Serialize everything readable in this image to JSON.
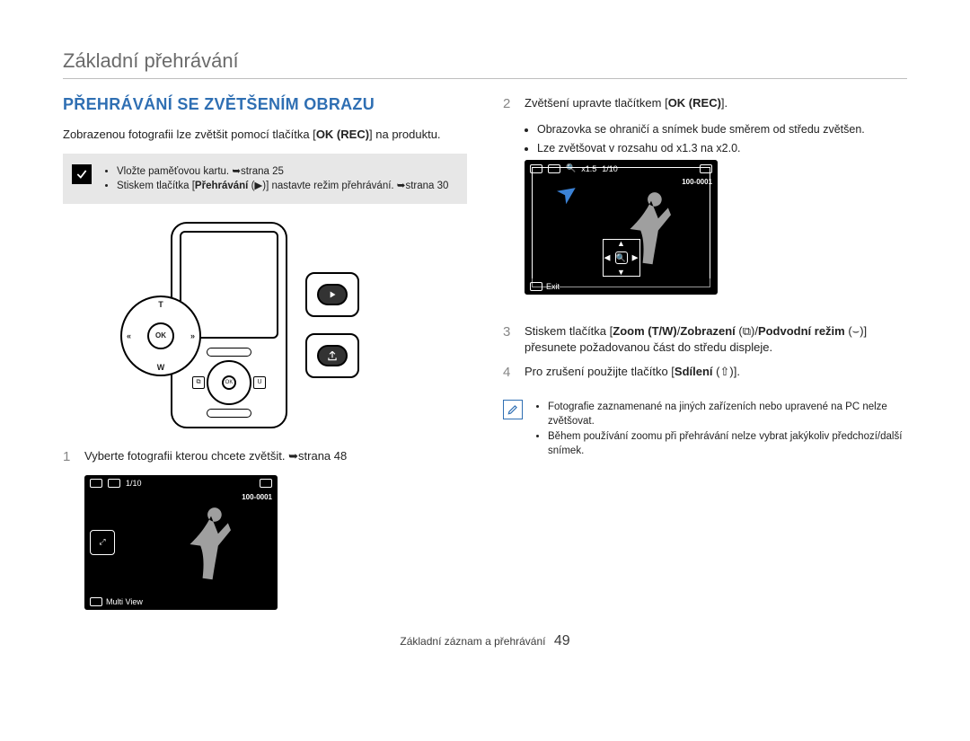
{
  "header": {
    "section_title": "Základní přehrávání"
  },
  "left": {
    "h2": "PŘEHRÁVÁNÍ SE ZVĚTŠENÍM OBRAZU",
    "intro_a": "Zobrazenou fotografii lze zvětšit pomocí tlačítka [",
    "intro_b": "OK (REC)",
    "intro_c": "] na produktu.",
    "prereq": {
      "item1": "Vložte paměťovou kartu. ➥strana 25",
      "item2a": "Stiskem tlačítka [",
      "item2b": "Přehrávání",
      "item2c": " (▶)] nastavte režim přehrávání. ➥strana 30"
    },
    "device": {
      "T": "T",
      "W": "W",
      "L": "«",
      "R": "»",
      "OK": "OK",
      "side_left": "⧉",
      "side_right": "U"
    },
    "step1": {
      "num": "1",
      "text": "Vyberte fotografii kterou chcete zvětšit. ➥strana 48"
    },
    "shot1": {
      "counter": "1/10",
      "file": "100-0001",
      "bottom_label": "Multi View",
      "zoom_icon_label": "⤢"
    }
  },
  "right": {
    "step2": {
      "num": "2",
      "text_a": "Zvětšení upravte tlačítkem [",
      "text_b": "OK (REC)",
      "text_c": "].",
      "bullet1": "Obrazovka se ohraničí a snímek bude směrem od středu zvětšen.",
      "bullet2": "Lze zvětšovat v rozsahu od x1.3 na x2.0."
    },
    "shot2": {
      "zoom": "x1.5",
      "counter": "1/10",
      "file": "100-0001",
      "bottom_label": "Exit"
    },
    "step3": {
      "num": "3",
      "text_a": "Stiskem tlačítka [",
      "text_b": "Zoom (T/W)",
      "text_c": "/",
      "text_d": "Zobrazení",
      "text_e": " (⧉)/",
      "text_f": "Podvodní režim",
      "text_g": " (⌣)] přesunete požadovanou část do středu displeje."
    },
    "step4": {
      "num": "4",
      "text_a": "Pro zrušení použijte tlačítko [",
      "text_b": "Sdílení",
      "text_c": " (⇧)]."
    },
    "notes": {
      "n1": "Fotografie zaznamenané na jiných zařízeních nebo upravené na PC nelze zvětšovat.",
      "n2": "Během používání zoomu při přehrávání nelze vybrat jakýkoliv předchozí/další snímek."
    }
  },
  "footer": {
    "chapter": "Základní záznam a přehrávání",
    "page": "49"
  }
}
